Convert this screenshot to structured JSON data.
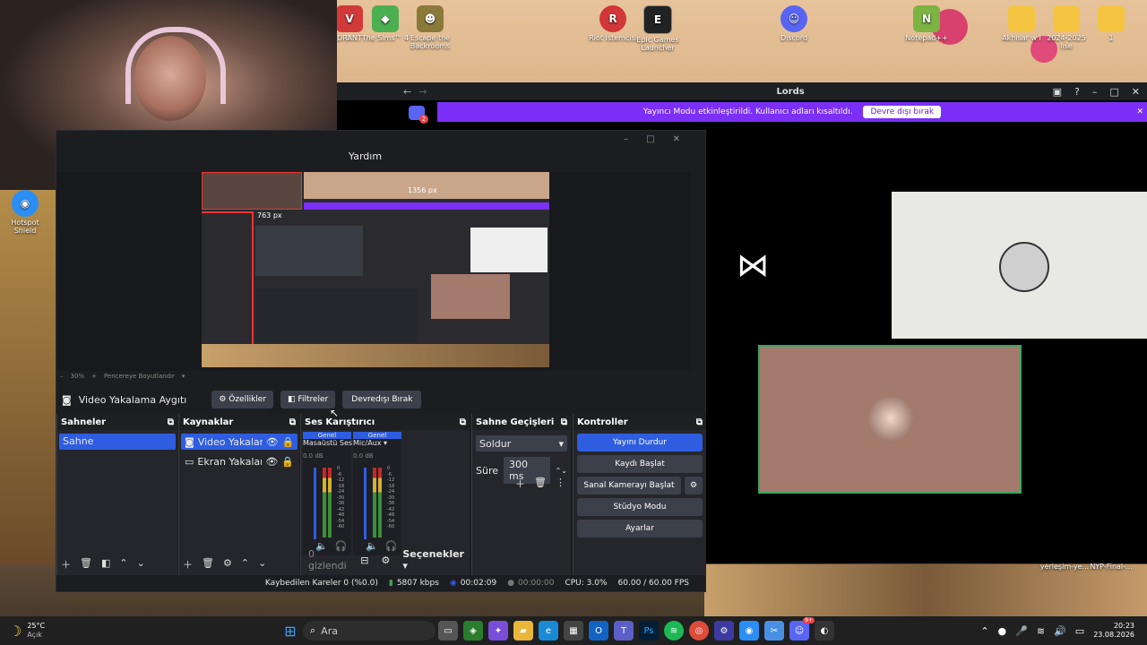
{
  "desktop": {
    "icons": [
      {
        "label": "DRANT",
        "color": "#d23a3a"
      },
      {
        "label": "The Sims™ 4",
        "color": "#4caf50"
      },
      {
        "label": "Escape the Backrooms",
        "color": "#8a7a3a"
      },
      {
        "label": "Riot İstemcisi",
        "color": "#d13639"
      },
      {
        "label": "Epic Games Launcher",
        "color": "#222222"
      },
      {
        "label": "Discord",
        "color": "#5865f2"
      },
      {
        "label": "Notepad++",
        "color": "#7cb342"
      },
      {
        "label": "Akhisar w i",
        "color": "#f5c542"
      },
      {
        "label": "2024-2025 lise",
        "color": "#f5c542"
      },
      {
        "label": "1",
        "color": "#f5c542"
      },
      {
        "label": "Hotspot Shield",
        "color": "#2b8ef5"
      },
      {
        "label": "yerleşim-ye...",
        "color": "#ffffff"
      },
      {
        "label": "NYP-Final-...",
        "color": "#ffffff"
      }
    ]
  },
  "discord": {
    "title": "Lords",
    "banner_text": "Yayıncı Modu etkinleştirildi. Kullanıcı adları kısaltıldı.",
    "banner_button": "Devre dışı bırak",
    "badge": "2"
  },
  "obs": {
    "menu_help": "Yardım",
    "preview_px_width": "1356 px",
    "preview_px_height": "763 px",
    "zoom": "30%",
    "zoom_mode": "Pencereye Boyutlandır",
    "source_bar": {
      "source_name": "Video Yakalama Aygıtı",
      "properties": "Özellikler",
      "filters": "Filtreler",
      "deactivate": "Devredışı Bırak"
    },
    "scenes": {
      "title": "Sahneler",
      "items": [
        "Sahne"
      ]
    },
    "sources": {
      "title": "Kaynaklar",
      "items": [
        "Video Yakalama Aygıtı",
        "Ekran Yakalama"
      ]
    },
    "mixer": {
      "title": "Ses Karıştırıcı",
      "channels": [
        {
          "tag": "Genel",
          "name": "Masaüstü Ses",
          "db": "0.0 dB"
        },
        {
          "tag": "Genel",
          "name": "Mic/Aux",
          "db": "0.0 dB"
        }
      ],
      "scale": [
        "0",
        "-6",
        "-12",
        "-18",
        "-24",
        "-30",
        "-36",
        "-42",
        "-48",
        "-54",
        "-60"
      ],
      "hidden": "0 gizlendi",
      "options": "Seçenekler"
    },
    "transitions": {
      "title": "Sahne Geçişleri",
      "type": "Soldur",
      "duration_label": "Süre",
      "duration": "300 ms"
    },
    "controls": {
      "title": "Kontroller",
      "stop_stream": "Yayını Durdur",
      "start_record": "Kaydı Başlat",
      "virtual_cam": "Sanal Kamerayı Başlat",
      "studio": "Stüdyo Modu",
      "settings": "Ayarlar"
    },
    "status": {
      "dropped": "Kaybedilen Kareler 0 (%0.0)",
      "bitrate": "5807 kbps",
      "stream_time": "00:02:09",
      "record_time": "00:00:00",
      "cpu": "CPU: 3.0%",
      "fps": "60.00 / 60.00 FPS"
    }
  },
  "taskbar": {
    "weather_temp": "25°C",
    "weather_desc": "Açık",
    "search": "Ara",
    "time": "20:23",
    "date": "23.08.2026",
    "notif_badge": "9+"
  },
  "colors": {
    "accent_blue": "#2f5de0",
    "discord_purple": "#7b2ff7",
    "tile_rose": "#a47a6c"
  }
}
